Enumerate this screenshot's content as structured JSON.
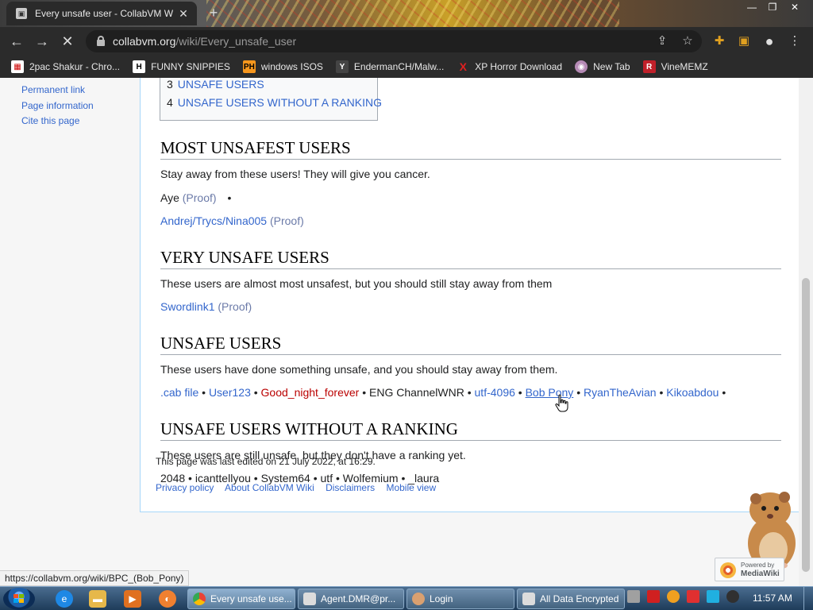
{
  "browser": {
    "tab_title": "Every unsafe user - CollabVM W",
    "tab_close": "✕",
    "new_tab": "+",
    "url_host": "collabvm.org",
    "url_path": "/wiki/Every_unsafe_user",
    "bookmarks": [
      {
        "label": "2pac Shakur - Chro...",
        "icon": "calendar-icon",
        "color": "#ffffff"
      },
      {
        "label": "FUNNY SNIPPIES",
        "icon": "H",
        "color": "#ffffff"
      },
      {
        "label": "windows ISOS",
        "icon": "PH",
        "color": "#f7971d"
      },
      {
        "label": "EndermanCH/Malw...",
        "icon": "YP",
        "color": "#222222"
      },
      {
        "label": "XP Horror Download",
        "icon": "X",
        "color": "#e02020"
      },
      {
        "label": "New Tab",
        "icon": "globe-icon",
        "color": "#a060a0"
      },
      {
        "label": "VineMEMZ",
        "icon": "R",
        "color": "#c0202a"
      }
    ]
  },
  "sidebar": {
    "links": [
      "Permanent link",
      "Page information",
      "Cite this page"
    ]
  },
  "toc": {
    "items": [
      {
        "num": "3",
        "text": "UNSAFE USERS"
      },
      {
        "num": "4",
        "text": "UNSAFE USERS WITHOUT A RANKING"
      }
    ]
  },
  "sections": {
    "most": {
      "title": "MOST UNSAFEST USERS",
      "intro": "Stay away from these users! They will give you cancer.",
      "line1_name": "Aye",
      "line1_proof": "(Proof)",
      "line1_sep": "•",
      "line2_name": "Andrej/Trycs/Nina005",
      "line2_proof": "(Proof)"
    },
    "very": {
      "title": "VERY UNSAFE USERS",
      "intro": "These users are almost most unsafest, but you should still stay away from them",
      "name": "Swordlink1",
      "proof": "(Proof)"
    },
    "unsafe": {
      "title": "UNSAFE USERS",
      "intro": "These users have done something unsafe, and you should stay away from them.",
      "users": [
        ".cab file",
        "User123",
        "Good_night_forever",
        "ENG ChannelWNR",
        "utf-4096",
        "Bob Pony",
        "RyanTheAvian",
        "Kikoabdou"
      ],
      "sep": "•"
    },
    "unranked": {
      "title": "UNSAFE USERS WITHOUT A RANKING",
      "intro": "These users are still unsafe, but they don't have a ranking yet.",
      "users": [
        "2048",
        "icanttellyou",
        "System64",
        "utf",
        "Wolfemium",
        "_laura"
      ],
      "sep": "•"
    }
  },
  "footer": {
    "last_edited": "This page was last edited on 21 July 2022, at 16:29.",
    "links": [
      "Privacy policy",
      "About CollabVM Wiki",
      "Disclaimers",
      "Mobile view"
    ],
    "badge_small": "Powered by",
    "badge_big": "MediaWiki"
  },
  "status_url": "https://collabvm.org/wiki/BPC_(Bob_Pony)",
  "taskbar": {
    "tasks": [
      "Every unsafe use...",
      "Agent.DMR@pr...",
      "Login",
      "All Data Encrypted"
    ],
    "clock": "11:57 AM"
  }
}
